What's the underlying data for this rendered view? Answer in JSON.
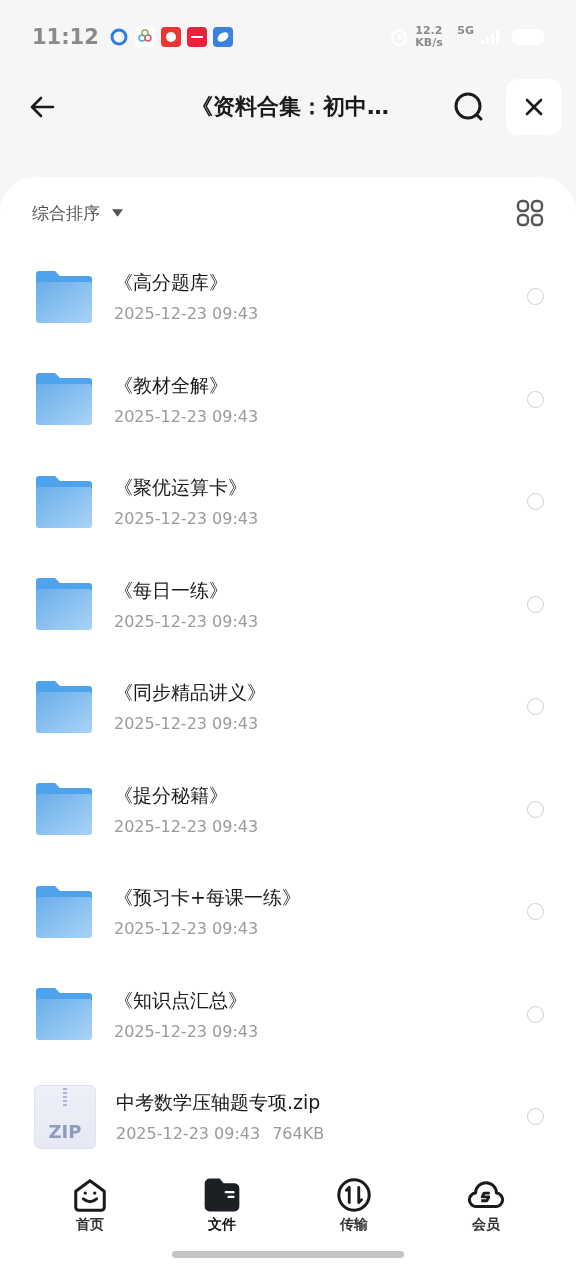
{
  "status_bar": {
    "time": "11:12",
    "net_speed": "12.2 KB/s",
    "network": "5G"
  },
  "header": {
    "title": "《资料合集：初中…"
  },
  "sort": {
    "label": "综合排序"
  },
  "files": [
    {
      "kind": "folder",
      "name": "《高分题库》",
      "date": "2025-12-23 09:43",
      "selected": false
    },
    {
      "kind": "folder",
      "name": "《教材全解》",
      "date": "2025-12-23 09:43",
      "selected": false
    },
    {
      "kind": "folder",
      "name": "《聚优运算卡》",
      "date": "2025-12-23 09:43",
      "selected": false
    },
    {
      "kind": "folder",
      "name": "《每日一练》",
      "date": "2025-12-23 09:43",
      "selected": false
    },
    {
      "kind": "folder",
      "name": "《同步精品讲义》",
      "date": "2025-12-23 09:43",
      "selected": false
    },
    {
      "kind": "folder",
      "name": "《提分秘籍》",
      "date": "2025-12-23 09:43",
      "selected": false
    },
    {
      "kind": "folder",
      "name": "《预习卡+每课一练》",
      "date": "2025-12-23 09:43",
      "selected": false
    },
    {
      "kind": "folder",
      "name": "《知识点汇总》",
      "date": "2025-12-23 09:43",
      "selected": false
    },
    {
      "kind": "zip",
      "name": "中考数学压轴题专项.zip",
      "date": "2025-12-23 09:43",
      "size": "764KB",
      "badge": "ZIP",
      "selected": false
    }
  ],
  "nav": [
    {
      "kind": "home",
      "label": "首页",
      "selected": false
    },
    {
      "kind": "files",
      "label": "文件",
      "selected": true
    },
    {
      "kind": "transfer",
      "label": "传输",
      "selected": false
    },
    {
      "kind": "member",
      "label": "会员",
      "selected": false
    }
  ]
}
